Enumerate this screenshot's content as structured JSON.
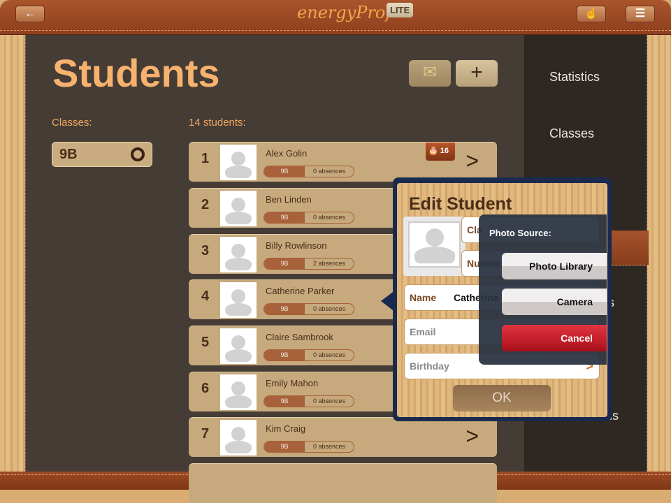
{
  "topbar": {
    "logo": "energyProf",
    "badge": "LITE",
    "back_icon": "arrow-left-icon",
    "touch_icon": "hand-pointer-icon",
    "menu_icon": "hamburger-menu-icon"
  },
  "page": {
    "title": "Students",
    "classes_label": "Classes:",
    "students_label": "14 students:",
    "selected_class": "9B"
  },
  "header_buttons": {
    "mail_icon": "envelope-icon",
    "add_label": "+"
  },
  "students": [
    {
      "num": "1",
      "name": "Alex Golin",
      "class": "9B",
      "absences": "0 absences",
      "birthday_badge": "16"
    },
    {
      "num": "2",
      "name": "Ben Linden",
      "class": "9B",
      "absences": "0 absences"
    },
    {
      "num": "3",
      "name": "Billy Rowlinson",
      "class": "9B",
      "absences": "2 absences"
    },
    {
      "num": "4",
      "name": "Catherine Parker",
      "class": "9B",
      "absences": "0 absences"
    },
    {
      "num": "5",
      "name": "Claire Sambrook",
      "class": "9B",
      "absences": "0 absences"
    },
    {
      "num": "6",
      "name": "Emily Mahon",
      "class": "9B",
      "absences": "0 absences"
    },
    {
      "num": "7",
      "name": "Kim Craig",
      "class": "9B",
      "absences": "0 absences"
    }
  ],
  "sidebar": {
    "items": [
      "Statistics",
      "Classes",
      "s",
      "us"
    ]
  },
  "edit": {
    "title": "Edit Student",
    "class_label": "Cla",
    "number_label": "Numbe",
    "name_label": "Name",
    "name_value": "Catherine",
    "email_placeholder": "Email",
    "birthday_label": "Birthday",
    "ok": "OK",
    "chevron": ">"
  },
  "sheet": {
    "title": "Photo Source:",
    "photo_library": "Photo Library",
    "camera": "Camera",
    "cancel": "Cancel"
  },
  "colors": {
    "accent": "#f7b26e",
    "leather": "#9e4a24",
    "cancel": "#d42432"
  }
}
